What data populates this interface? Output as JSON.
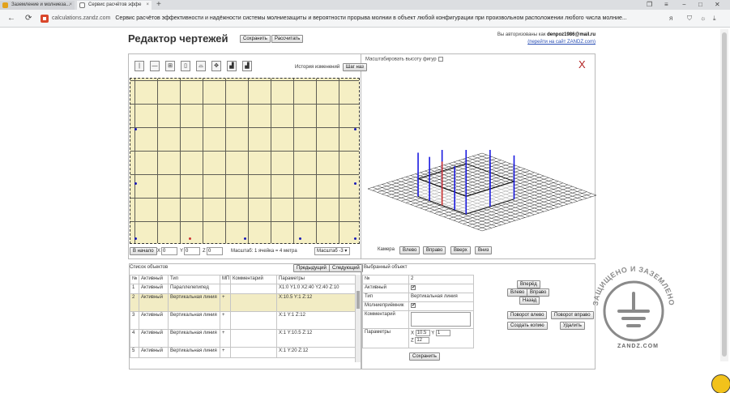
{
  "browser": {
    "tabs": [
      {
        "label": "Заземление и молниеза...",
        "close": "×"
      },
      {
        "label": "Сервис расчётов эффе",
        "close": "×"
      }
    ],
    "new_tab": "+",
    "url_host": "calculations.zandz.com",
    "url_title": "Сервис расчётов эффективности и надёжности системы молниезащиты и вероятности прорыва молнии в объект любой конфигурации при произвольном расположении любого числа молние...",
    "icons": [
      "back-icon",
      "forward-icon",
      "reload-icon"
    ]
  },
  "page": {
    "title": "Редактор чертежей",
    "save_label": "Сохранить",
    "calc_label": "Рассчитать",
    "auth_text": "Вы авторизованы как",
    "auth_user": "denpoz1986@mail.ru",
    "site_link": "(перейти на сайт ZANDZ.com)"
  },
  "toolbar": {
    "tools": [
      "|",
      "—",
      "⊞",
      "▯",
      "⌓",
      "✥",
      "▟",
      "▟"
    ],
    "history_label": "История изменений",
    "step_label": "Шаг наз"
  },
  "scalebar": {
    "home_label": "В начало",
    "x_label": "X",
    "x_value": "0",
    "y_label": "Y",
    "y_value": "0",
    "z_label": "Z",
    "z_value": "0",
    "scale_text": "Масштаб: 1 ячейка = 4 метра",
    "scale_select": "Масштаб -3 ▾"
  },
  "view3d": {
    "scale_height_label": "Масштабировать высоту фигур",
    "close_label": "X",
    "camera_label": "Камера",
    "buttons": [
      "Влево",
      "Вправо",
      "Вверх",
      "Вниз"
    ]
  },
  "objects": {
    "header": "Список объектов",
    "prev_label": "Предыдущий",
    "next_label": "Следующий",
    "columns": [
      "№",
      "Активный",
      "Тип",
      "МП",
      "Комментарий",
      "Параметры"
    ],
    "rows": [
      {
        "n": "1",
        "active": "Активный",
        "type": "Параллелепипед",
        "mp": "",
        "comment": "",
        "params": "X1:0 Y1:0 X2:40 Y2:40 Z:10"
      },
      {
        "n": "2",
        "active": "Активный",
        "type": "Вертикальная линия",
        "mp": "+",
        "comment": "",
        "params": "X:10.5 Y:1 Z:12"
      },
      {
        "n": "3",
        "active": "Активный",
        "type": "Вертикальная линия",
        "mp": "+",
        "comment": "",
        "params": "X:1 Y:1 Z:12"
      },
      {
        "n": "4",
        "active": "Активный",
        "type": "Вертикальная линия",
        "mp": "+",
        "comment": "",
        "params": "X:1 Y:10.5 Z:12"
      },
      {
        "n": "5",
        "active": "Активный",
        "type": "Вертикальная линия",
        "mp": "+",
        "comment": "",
        "params": "X:1 Y:20 Z:12"
      }
    ]
  },
  "selected": {
    "header": "Выбранный объект",
    "n_label": "№",
    "n_value": "2",
    "active_label": "Активный",
    "active_check": "✔",
    "type_label": "Тип",
    "type_value": "Вертикальная линия",
    "mp_label": "Молниеприёмник",
    "mp_check": "✔",
    "comment_label": "Комментарий",
    "params_label": "Параметры",
    "x_label": "X",
    "x_value": "10.5",
    "y_label": "Y",
    "y_value": "1",
    "z_label": "Z",
    "z_value": "12",
    "save_label": "Сохранить"
  },
  "controls": {
    "forward": "Вперёд",
    "left": "Влево",
    "right": "Вправо",
    "back": "Назад",
    "rot_left": "Поворот влево",
    "rot_right": "Поворот вправо",
    "copy": "Создать копию",
    "delete": "Удалить"
  },
  "watermark": {
    "arc_text": "ЗАЩИЩЕНО И ЗАЗЕМЛЕНО",
    "site": "ZANDZ.COM"
  }
}
